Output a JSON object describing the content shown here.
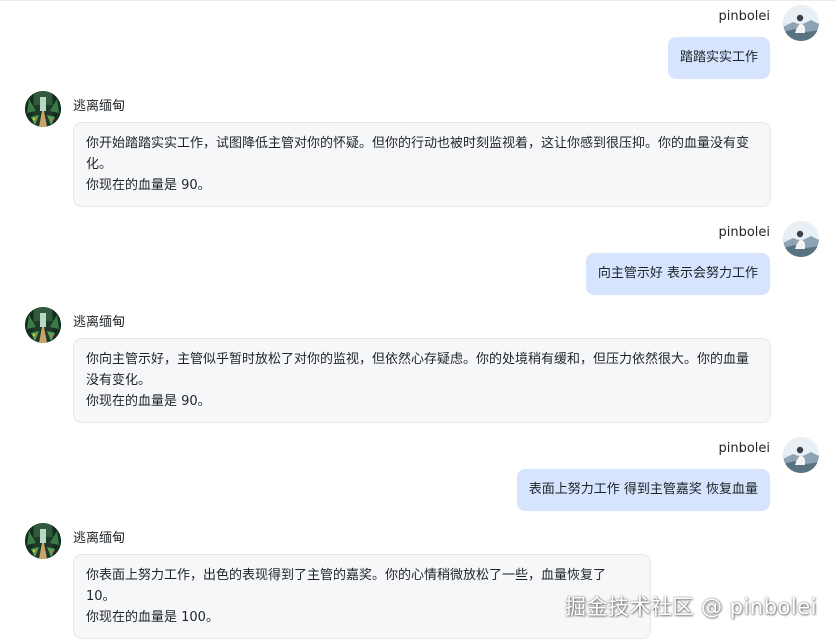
{
  "user": {
    "name": "pinbolei"
  },
  "bot": {
    "name": "逃离缅甸"
  },
  "messages": [
    {
      "role": "user",
      "text": "踏踏实实工作"
    },
    {
      "role": "bot",
      "lines": [
        "你开始踏踏实实工作，试图降低主管对你的怀疑。但你的行动也被时刻监视着，这让你感到很压抑。你的血量没有变化。",
        "你现在的血量是 90。"
      ]
    },
    {
      "role": "user",
      "text": "向主管示好 表示会努力工作"
    },
    {
      "role": "bot",
      "lines": [
        "你向主管示好，主管似乎暂时放松了对你的监视，但依然心存疑虑。你的处境稍有缓和，但压力依然很大。你的血量没有变化。",
        "你现在的血量是 90。"
      ]
    },
    {
      "role": "user",
      "text": "表面上努力工作 得到主管嘉奖 恢复血量"
    },
    {
      "role": "bot",
      "lines": [
        "你表面上努力工作，出色的表现得到了主管的嘉奖。你的心情稍微放松了一些，血量恢复了 10。",
        "你现在的血量是 100。"
      ]
    }
  ],
  "watermark": "掘金技术社区 @ pinbolei",
  "colors": {
    "user_bubble": "#d6e4fd",
    "bot_bubble": "#f6f7f9",
    "bot_border": "#e6e8eb"
  },
  "icons": {
    "user_avatar": "user-avatar-icon",
    "bot_avatar": "forest-avatar-icon"
  }
}
